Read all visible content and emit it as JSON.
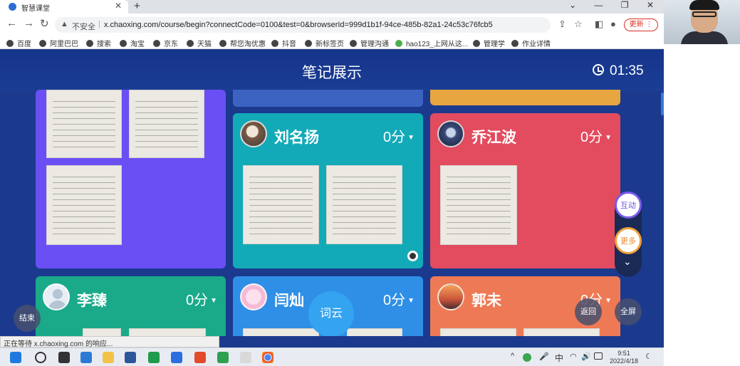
{
  "browser": {
    "tab_title": "智慧课堂",
    "tab_close": "✕",
    "new_tab": "+",
    "window_controls": [
      "⌄",
      "—",
      "❐",
      "✕"
    ],
    "back": "←",
    "forward": "→",
    "reload": "↻",
    "warn_icon": "▲",
    "not_secure": "不安全",
    "separator": "|",
    "url": "x.chaoxing.com/course/begin?connectCode=0100&test=0&browserId=999d1b1f-94ce-485b-82a1-24c53c76fcb5",
    "update_label": "更新 ⋮",
    "bookmarks": [
      "百度",
      "阿里巴巴",
      "搜索",
      "淘宝",
      "京东",
      "天猫",
      "帮您淘优惠",
      "抖音",
      "新标签页",
      "管理沟通",
      "hao123_上网从这...",
      "管理学",
      "作业详情"
    ]
  },
  "app": {
    "title": "笔记展示",
    "timer": "01:35",
    "side": {
      "interact": "互动",
      "more": "更多",
      "collapse": "⌄"
    },
    "end_label": "结束",
    "wordcloud_label": "词云",
    "back_label": "返回",
    "fullscreen_label": "全屏"
  },
  "cards": [
    {
      "name": "刘名扬",
      "score": "0分"
    },
    {
      "name": "乔江波",
      "score": "0分"
    },
    {
      "name": "李臻",
      "score": "0分"
    },
    {
      "name": "闫灿",
      "score": "0分"
    },
    {
      "name": "郭未",
      "score": "0分"
    }
  ],
  "score_caret": "▼",
  "status": {
    "text": "正在等待 x.chaoxing.com 的响应..."
  },
  "tray": {
    "time": "9:51",
    "date": "2022/4/18",
    "ime": "中",
    "items": [
      "^",
      "🔊"
    ]
  },
  "colors": {
    "purple": "#6a4ff5",
    "teal": "#13aab8",
    "red": "#e34b5f",
    "green": "#1aaa8a",
    "blue": "#2f8fe6",
    "orange": "#ee7a55",
    "amber": "#e8a640"
  }
}
